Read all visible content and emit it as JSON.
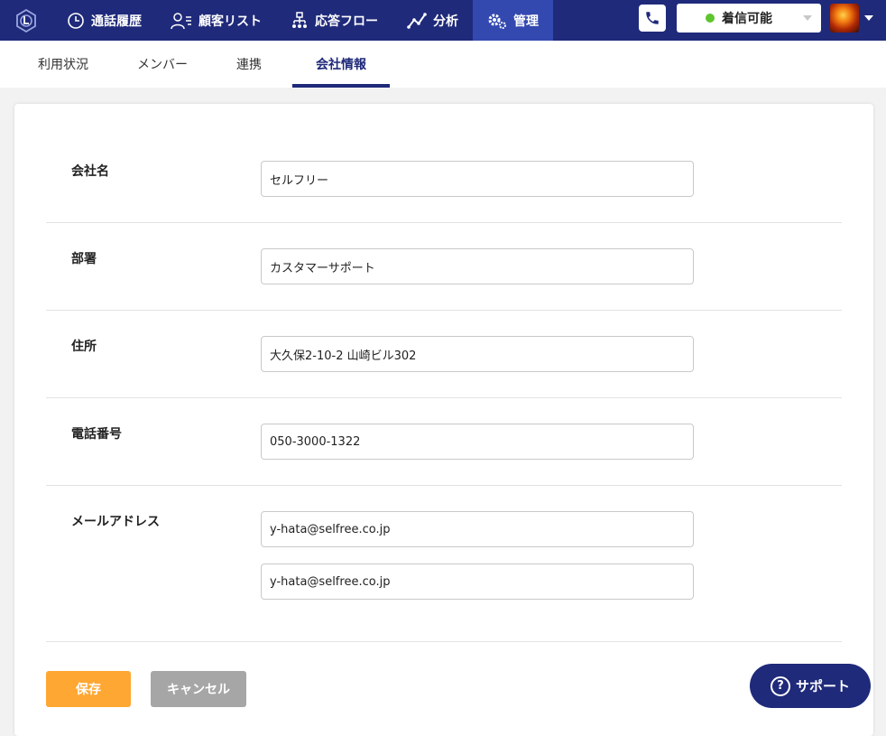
{
  "nav": {
    "items": [
      {
        "label": "通話履歴",
        "icon": "clock-icon"
      },
      {
        "label": "顧客リスト",
        "icon": "customer-list-icon"
      },
      {
        "label": "応答フロー",
        "icon": "flow-icon"
      },
      {
        "label": "分析",
        "icon": "chart-line-icon"
      },
      {
        "label": "管理",
        "icon": "gear-icon"
      }
    ],
    "active_index": 4,
    "status": "着信可能",
    "status_color": "#5fc52e",
    "brand_color": "#1f2a7a",
    "active_color": "#3349b0"
  },
  "subtabs": {
    "items": [
      {
        "label": "利用状況"
      },
      {
        "label": "メンバー"
      },
      {
        "label": "連携"
      },
      {
        "label": "会社情報"
      }
    ],
    "active_index": 3
  },
  "form": {
    "company_name": {
      "label": "会社名",
      "value": "セルフリー"
    },
    "department": {
      "label": "部署",
      "value": "カスタマーサポート"
    },
    "address": {
      "label": "住所",
      "value": "大久保2-10-2 山崎ビル302"
    },
    "phone": {
      "label": "電話番号",
      "value": "050-3000-1322"
    },
    "email": {
      "label": "メールアドレス",
      "values": [
        "y-hata@selfree.co.jp",
        "y-hata@selfree.co.jp"
      ]
    }
  },
  "actions": {
    "save": "保存",
    "cancel": "キャンセル"
  },
  "support": {
    "label": "サポート",
    "icon": "question-circle-icon"
  },
  "colors": {
    "save": "#ffa733",
    "cancel": "#a6a6a6"
  }
}
